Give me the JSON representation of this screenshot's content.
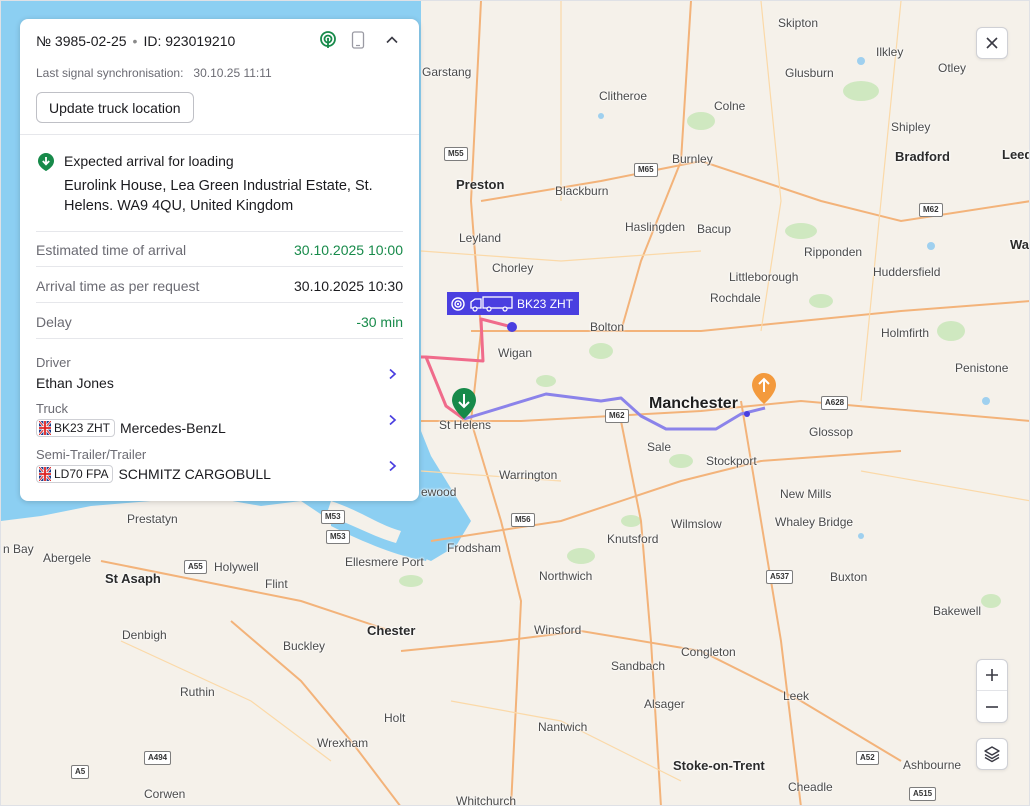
{
  "panel": {
    "order_number": "№ 3985-02-25",
    "separator": "•",
    "order_id": "ID: 923019210",
    "sync_label": "Last signal synchronisation:",
    "sync_time": "30.10.25 11:11",
    "update_button": "Update truck location",
    "expected": {
      "title": "Expected arrival for loading",
      "address": "Eurolink House, Lea Green Industrial Estate, St. Helens. WA9 4QU, United Kingdom"
    },
    "rows": [
      {
        "label": "Estimated time of arrival",
        "value": "30.10.2025 10:00"
      },
      {
        "label": "Arrival time as per request",
        "value": "30.10.2025 10:30"
      },
      {
        "label": "Delay",
        "value": "-30 min"
      }
    ],
    "driver": {
      "label": "Driver",
      "value": "Ethan Jones"
    },
    "truck": {
      "label": "Truck",
      "plate": "BK23 ZHT",
      "model": "Mercedes-BenzL"
    },
    "trailer": {
      "label": "Semi-Trailer/Trailer",
      "plate": "LD70 FPA",
      "model": "SCHMITZ CARGOBULL"
    },
    "icons": [
      "signal-icon",
      "phone-icon",
      "chevron-up-icon",
      "chevron-right-icon",
      "uk-flag-icon",
      "arrival-pin-icon"
    ]
  },
  "map": {
    "truck_label": "BK23 ZHT",
    "places": {
      "skipton": "Skipton",
      "ilkley": "Ilkley",
      "garstang": "Garstang",
      "glusburn": "Glusburn",
      "otley": "Otley",
      "clitheroe": "Clitheroe",
      "colne": "Colne",
      "shipley": "Shipley",
      "preston": "Preston",
      "burnley": "Burnley",
      "bradford": "Bradford",
      "leeds": "Leed",
      "blackburn": "Blackburn",
      "haslingden": "Haslingden",
      "bacup": "Bacup",
      "leyland": "Leyland",
      "ripponden": "Ripponden",
      "wa": "Wa",
      "chorley": "Chorley",
      "littleborough": "Littleborough",
      "huddersfield": "Huddersfield",
      "rochdale": "Rochdale",
      "bolton": "Bolton",
      "holmfirth": "Holmfirth",
      "wigan": "Wigan",
      "penistone": "Penistone",
      "manchester": "Manchester",
      "st_helens": "St Helens",
      "sale": "Sale",
      "glossop": "Glossop",
      "stockport": "Stockport",
      "warrington": "Warrington",
      "ewood": "ewood",
      "new_mills": "New Mills",
      "prestatyn": "Prestatyn",
      "wilmslow": "Wilmslow",
      "whaley_bridge": "Whaley Bridge",
      "bay": "n Bay",
      "abergele": "Abergele",
      "holywell": "Holywell",
      "frodsham": "Frodsham",
      "knutsford": "Knutsford",
      "st_asaph": "St Asaph",
      "flint": "Flint",
      "ellesmere": "Ellesmere Port",
      "northwich": "Northwich",
      "buxton": "Buxton",
      "bakewell": "Bakewell",
      "chester": "Chester",
      "denbigh": "Denbigh",
      "winsford": "Winsford",
      "buckley": "Buckley",
      "congleton": "Congleton",
      "sandbach": "Sandbach",
      "ruthin": "Ruthin",
      "alsager": "Alsager",
      "leek": "Leek",
      "holt": "Holt",
      "nantwich": "Nantwich",
      "wrexham": "Wrexham",
      "stoke": "Stoke-on-Trent",
      "ashbourne": "Ashbourne",
      "cheadle": "Cheadle",
      "corwen": "Corwen",
      "whitchurch": "Whitchurch"
    },
    "roads": {
      "m55": "M55",
      "m65": "M65",
      "m62_e": "M62",
      "m62": "M62",
      "a628": "A628",
      "m53_a": "M53",
      "m53_b": "M53",
      "m56": "M56",
      "a55": "A55",
      "a537": "A537",
      "a494": "A494",
      "a5": "A5",
      "a52": "A52",
      "a515": "A515"
    }
  },
  "controls": {
    "close": "×",
    "zoom_in": "+",
    "zoom_out": "−",
    "icons": [
      "close-icon",
      "zoom-in-icon",
      "zoom-out-icon",
      "layers-icon"
    ]
  },
  "colors": {
    "route_done": "#f06b8b",
    "route_planned": "#8b83ea",
    "truck_label_bg": "#4a3fe0",
    "green": "#178a4a",
    "orange": "#f39a3d",
    "sea": "#8ccff2",
    "land": "#f5f1ea"
  }
}
